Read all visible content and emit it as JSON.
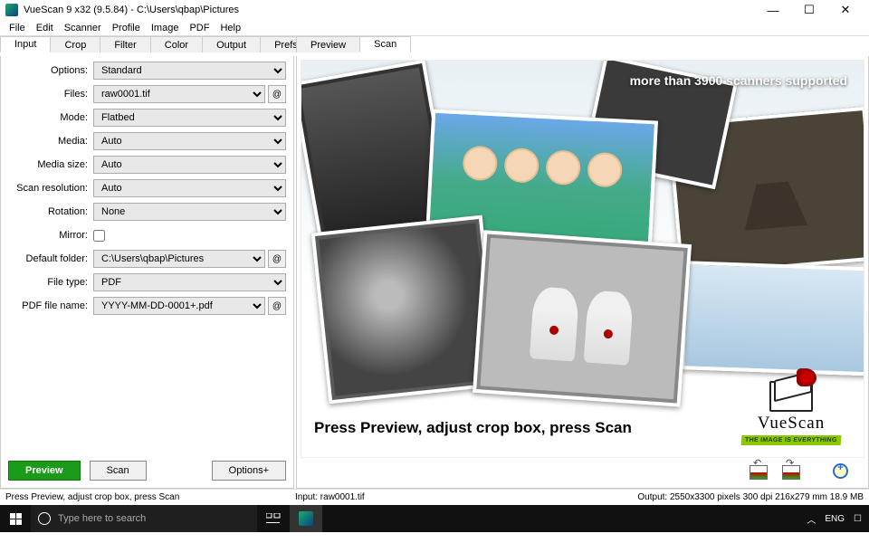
{
  "titlebar": {
    "title": "VueScan 9 x32 (9.5.84) - C:\\Users\\qbap\\Pictures"
  },
  "winbuttons": {
    "min": "—",
    "max": "☐",
    "close": "✕"
  },
  "menubar": [
    "File",
    "Edit",
    "Scanner",
    "Profile",
    "Image",
    "PDF",
    "Help"
  ],
  "left_tabs": [
    "Input",
    "Crop",
    "Filter",
    "Color",
    "Output",
    "Prefs"
  ],
  "left_active": 0,
  "right_tabs": [
    "Preview",
    "Scan"
  ],
  "right_active": 1,
  "form": {
    "options": {
      "label": "Options:",
      "value": "Standard"
    },
    "files": {
      "label": "Files:",
      "value": "raw0001.tif",
      "at": "@"
    },
    "mode": {
      "label": "Mode:",
      "value": "Flatbed"
    },
    "media": {
      "label": "Media:",
      "value": "Auto"
    },
    "media_size": {
      "label": "Media size:",
      "value": "Auto"
    },
    "scan_res": {
      "label": "Scan resolution:",
      "value": "Auto"
    },
    "rotation": {
      "label": "Rotation:",
      "value": "None"
    },
    "mirror": {
      "label": "Mirror:"
    },
    "default_folder": {
      "label": "Default folder:",
      "value": "C:\\Users\\qbap\\Pictures",
      "at": "@"
    },
    "file_type": {
      "label": "File type:",
      "value": "PDF"
    },
    "pdf_name": {
      "label": "PDF file name:",
      "value": "YYYY-MM-DD-0001+.pdf",
      "at": "@"
    }
  },
  "buttons": {
    "preview": "Preview",
    "scan": "Scan",
    "options": "Options+"
  },
  "banner": "more than 3900 scanners supported",
  "instruction": "Press Preview, adjust crop box, press Scan",
  "logo": {
    "name": "VueScan",
    "tag": "THE IMAGE IS EVERYTHING"
  },
  "statusbar": {
    "left": "Press Preview, adjust crop box, press Scan",
    "mid": "Input: raw0001.tif",
    "right": "Output: 2550x3300 pixels 300 dpi 216x279 mm 18.9 MB"
  },
  "taskbar": {
    "search_placeholder": "Type here to search",
    "tray": {
      "up": "︿",
      "lang": "ENG",
      "notif": "☐"
    }
  }
}
